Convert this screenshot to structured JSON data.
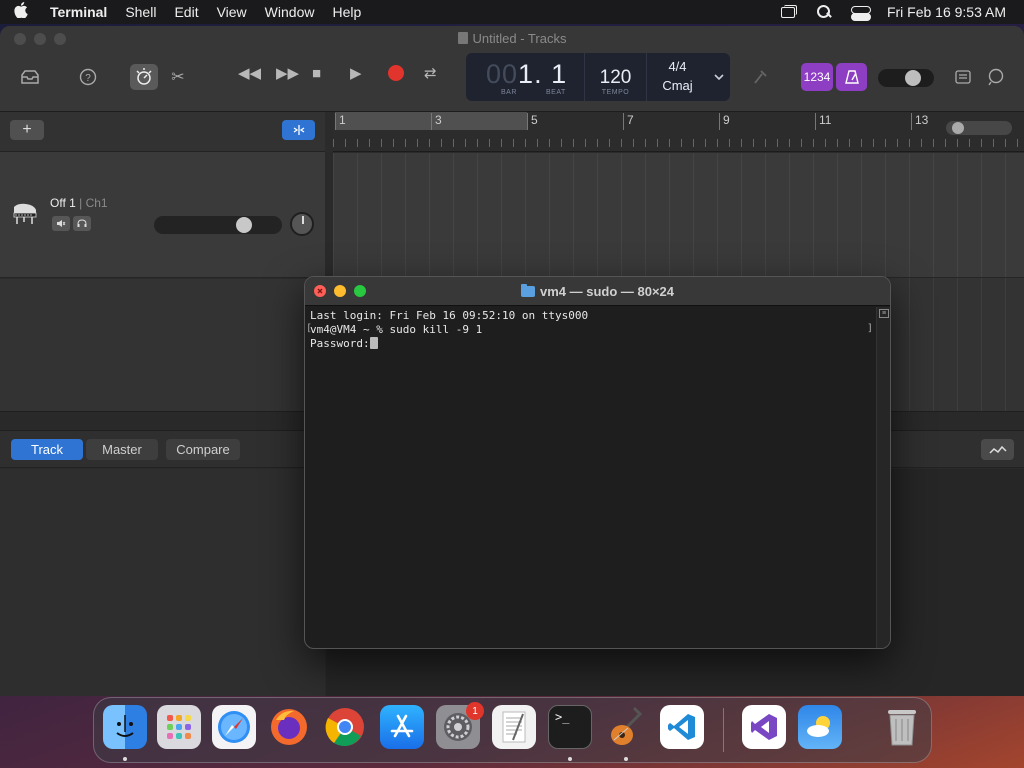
{
  "menubar": {
    "apple": "",
    "app": "Terminal",
    "items": [
      "Shell",
      "Edit",
      "View",
      "Window",
      "Help"
    ],
    "datetime": "Fri Feb 16  9:53 AM"
  },
  "garageband": {
    "title": "Untitled - Tracks",
    "lcd": {
      "bar_dim": "00",
      "bar": "1",
      "beat": ". 1",
      "bar_label": "BAR",
      "beat_label": "BEAT",
      "tempo": "120",
      "tempo_label": "TEMPO",
      "time_sig": "4/4",
      "key": "Cmaj"
    },
    "count_in": "1234",
    "ruler_numbers": [
      "1",
      "3",
      "5",
      "7",
      "9",
      "11",
      "13"
    ],
    "track": {
      "name": "Off 1",
      "channel": "| Ch1",
      "volume_level": 0.66
    },
    "editor_tabs": [
      "Track",
      "Master",
      "Compare"
    ],
    "active_tab": "Track"
  },
  "terminal": {
    "title": "vm4 — sudo — 80×24",
    "lines": {
      "login": "Last login: Fri Feb 16 09:52:10 on ttys000",
      "command": "vm4@VM4 ~ % sudo kill -9 1",
      "password": "Password:"
    }
  },
  "dock": {
    "items": [
      {
        "name": "finder-icon",
        "color": "#3a8ff0",
        "running": true
      },
      {
        "name": "launchpad-icon",
        "color": "#d8d8dc",
        "running": false
      },
      {
        "name": "safari-icon",
        "color": "#2f8ff5",
        "running": false
      },
      {
        "name": "firefox-icon",
        "color": "#f36a2c",
        "running": false
      },
      {
        "name": "chrome-icon",
        "color": "#ffffff",
        "running": false
      },
      {
        "name": "app-store-icon",
        "color": "#1d8cf4",
        "running": false
      },
      {
        "name": "system-settings-icon",
        "color": "#8a8a8e",
        "running": false,
        "badge": "1"
      },
      {
        "name": "textedit-icon",
        "color": "#f4f4f4",
        "running": false
      },
      {
        "name": "terminal-icon",
        "color": "#1d1d1d",
        "running": true
      },
      {
        "name": "garageband-icon",
        "color": "#3b2f2a",
        "running": true
      },
      {
        "name": "vscode-icon",
        "color": "#ffffff",
        "running": false
      },
      {
        "name": "visual-studio-icon",
        "color": "#ffffff",
        "running": false
      },
      {
        "name": "weather-icon",
        "color": "#3b8de6",
        "running": false
      },
      {
        "name": "trash-icon",
        "color": "#9a9a9a",
        "running": false
      }
    ]
  }
}
